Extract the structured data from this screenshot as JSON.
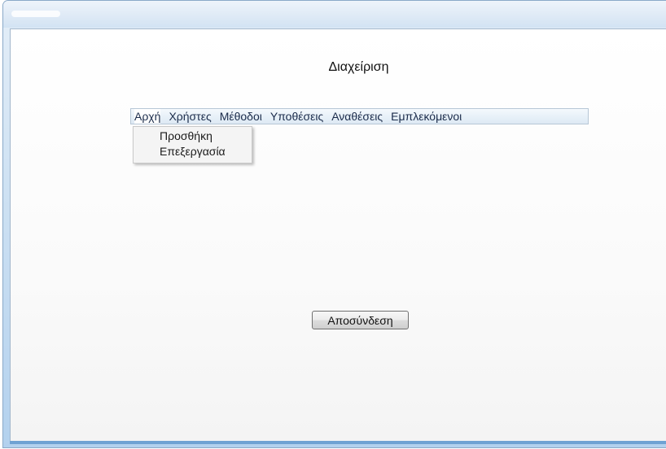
{
  "page": {
    "title": "Διαχείριση"
  },
  "menu": {
    "items": [
      "Αρχή",
      "Χρήστες",
      "Μέθοδοι",
      "Υποθέσεις",
      "Αναθέσεις",
      "Εμπλεκόμενοι"
    ],
    "open_submenu": [
      "Προσθήκη",
      "Επεξεργασία"
    ]
  },
  "actions": {
    "logout_label": "Αποσύνδεση"
  },
  "colors": {
    "window_frame": "#b3d1ee",
    "menubar_bg": "#dde9f4",
    "menu_text": "#1a2b4a"
  }
}
